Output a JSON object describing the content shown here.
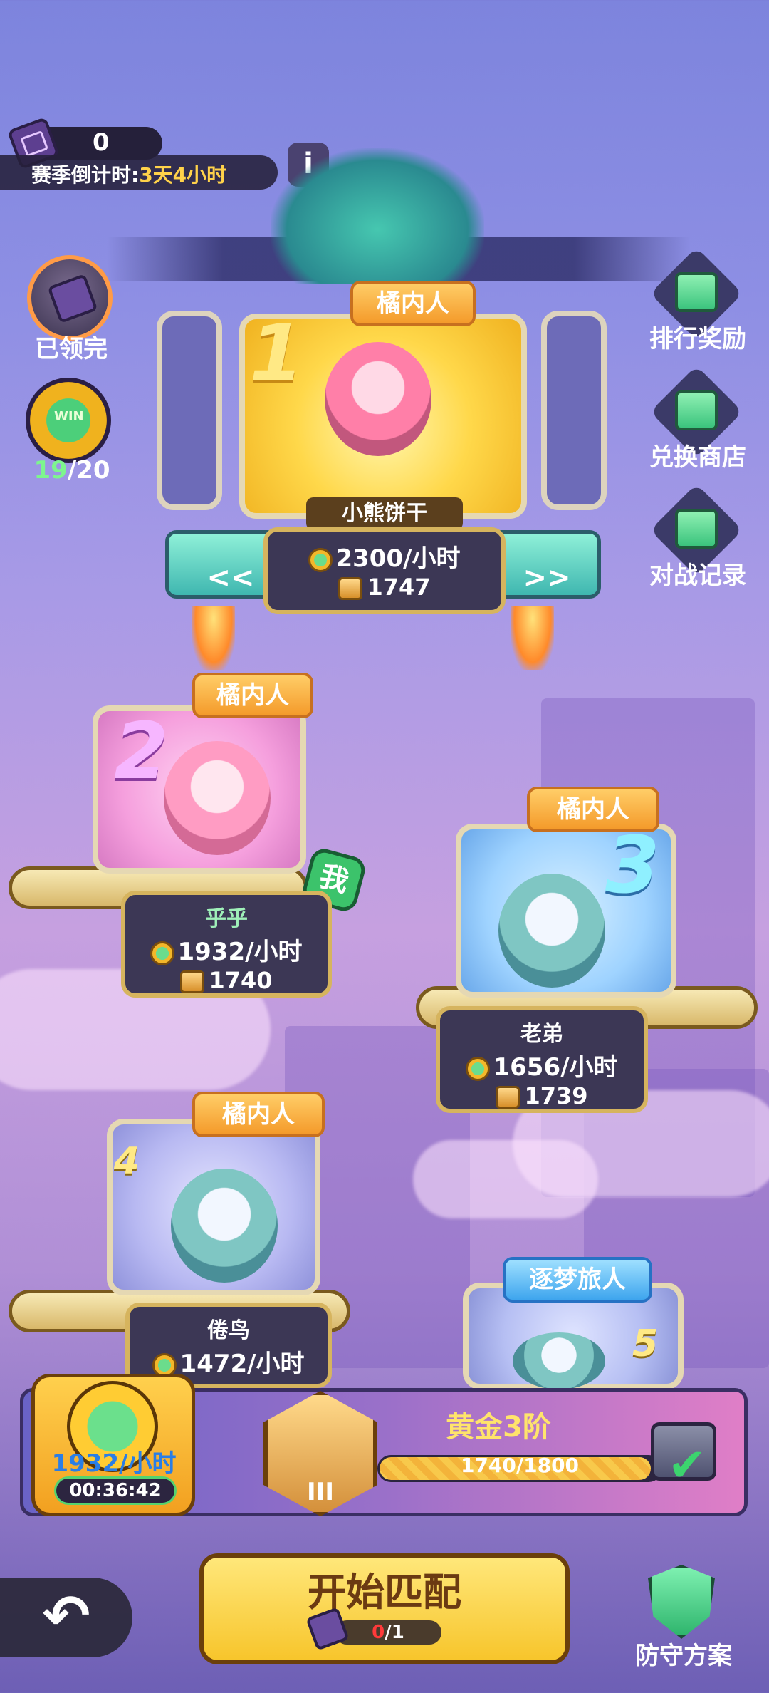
{
  "header": {
    "ticket_count": "0",
    "season_label": "赛季倒计时:",
    "season_value": "3天4小时",
    "info_icon": "i"
  },
  "left_buttons": {
    "claimed_label": "已领完",
    "win_coin_text": "WIN",
    "win_current": "19",
    "win_total": "/20"
  },
  "right_buttons": [
    {
      "label": "排行奖励",
      "icon": "gift-icon"
    },
    {
      "label": "兑换商店",
      "icon": "shop-icon"
    },
    {
      "label": "对战记录",
      "icon": "record-icon"
    }
  ],
  "podium": {
    "arrow_left": "<<",
    "arrow_right": ">>",
    "me_badge": "我",
    "players": [
      {
        "rank": "1",
        "team": "橘内人",
        "name": "小熊饼干",
        "rate": "2300/小时",
        "trophies": "1747"
      },
      {
        "rank": "2",
        "team": "橘内人",
        "name": "乎乎",
        "rate": "1932/小时",
        "trophies": "1740"
      },
      {
        "rank": "3",
        "team": "橘内人",
        "name": "老弟",
        "rate": "1656/小时",
        "trophies": "1739"
      },
      {
        "rank": "4",
        "team": "橘内人",
        "name": "倦鸟",
        "rate": "1472/小时",
        "trophies": ""
      },
      {
        "rank": "5",
        "team": "逐梦旅人",
        "name": "",
        "rate": "",
        "trophies": ""
      }
    ]
  },
  "bottom": {
    "earn_rate": "1932/小时",
    "earn_timer": "00:36:42",
    "rank_title": "黄金3阶",
    "rank_roman": "III",
    "rank_progress_text": "1740/1800",
    "rank_progress": 0.967
  },
  "controls": {
    "back_icon": "↶",
    "match_label": "开始匹配",
    "match_cost_used": "0",
    "match_cost_total": "/1",
    "defense_label": "防守方案"
  },
  "colors": {
    "gold": "#ffd24a",
    "green": "#7df58e",
    "accent_blue": "#2a7ee6"
  }
}
